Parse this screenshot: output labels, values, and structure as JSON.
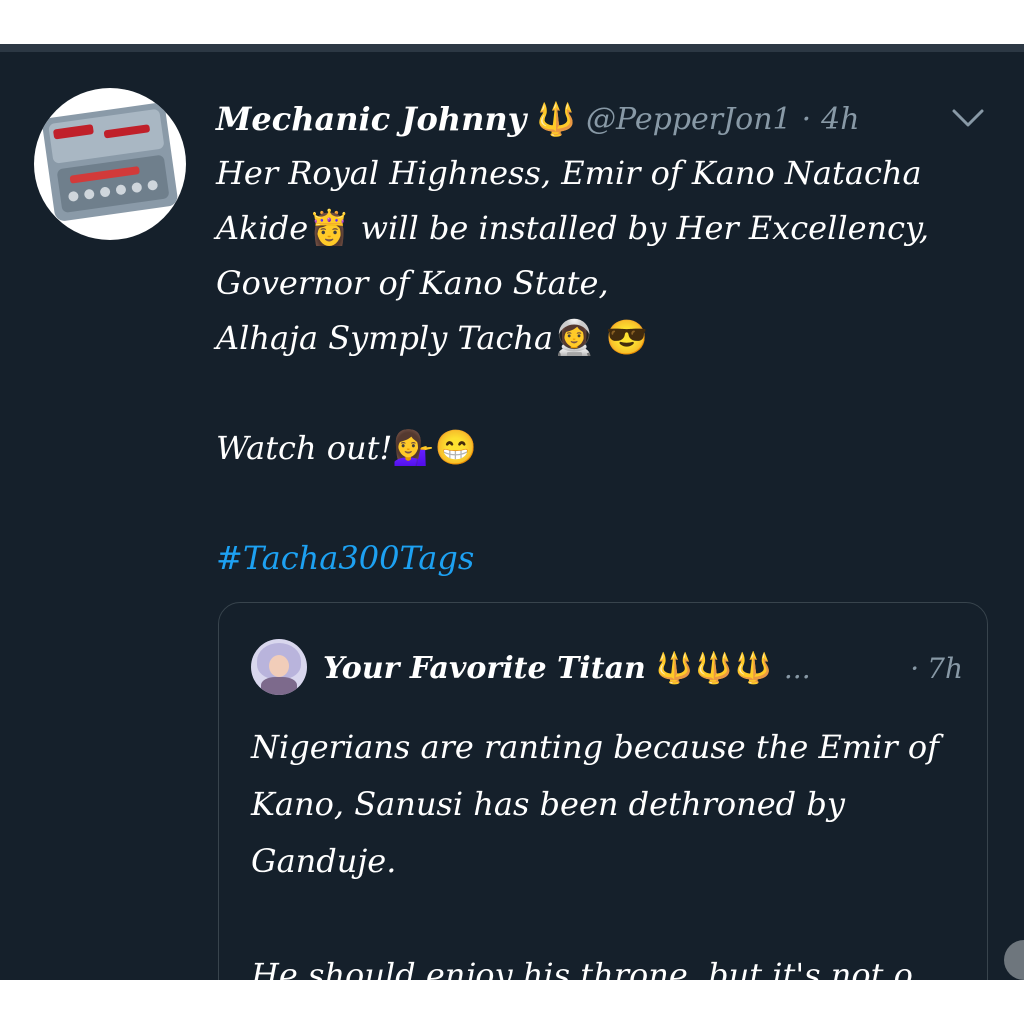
{
  "colors": {
    "background": "#15202b",
    "text": "#ffffff",
    "muted": "#8899a6",
    "link": "#1da1f2",
    "trident": "#f5a623",
    "border": "#38444d"
  },
  "tweet": {
    "display_name": "Mechanic Johnny",
    "name_emoji": "🔱",
    "handle": "@PepperJon1",
    "separator": "·",
    "time": "4h",
    "avatar_icon": "toolbox-icon",
    "menu_icon": "chevron-down-icon",
    "lines": [
      "Her Royal Highness, Emir of Kano Natacha",
      "Akide",
      "will be installed by Her Excellency,",
      "Governor of Kano State,",
      " Alhaja Symply Tacha",
      "Watch out!"
    ],
    "emojis": {
      "princess": "👸",
      "astronaut": "👩‍🚀",
      "cool": "😎",
      "tipping": "💁‍♀️",
      "grin": "😁"
    },
    "hashtag": "#Tacha300Tags"
  },
  "quoted": {
    "display_name": "Your Favorite Titan",
    "name_emojis": "🔱🔱🔱",
    "ellipsis": "...",
    "separator": "·",
    "time": "7h",
    "lines": [
      "Nigerians are ranting because the Emir of",
      "Kano, Sanusi has been dethroned by",
      "Ganduje.",
      "He should enjoy his throne, but it's not o..."
    ]
  }
}
